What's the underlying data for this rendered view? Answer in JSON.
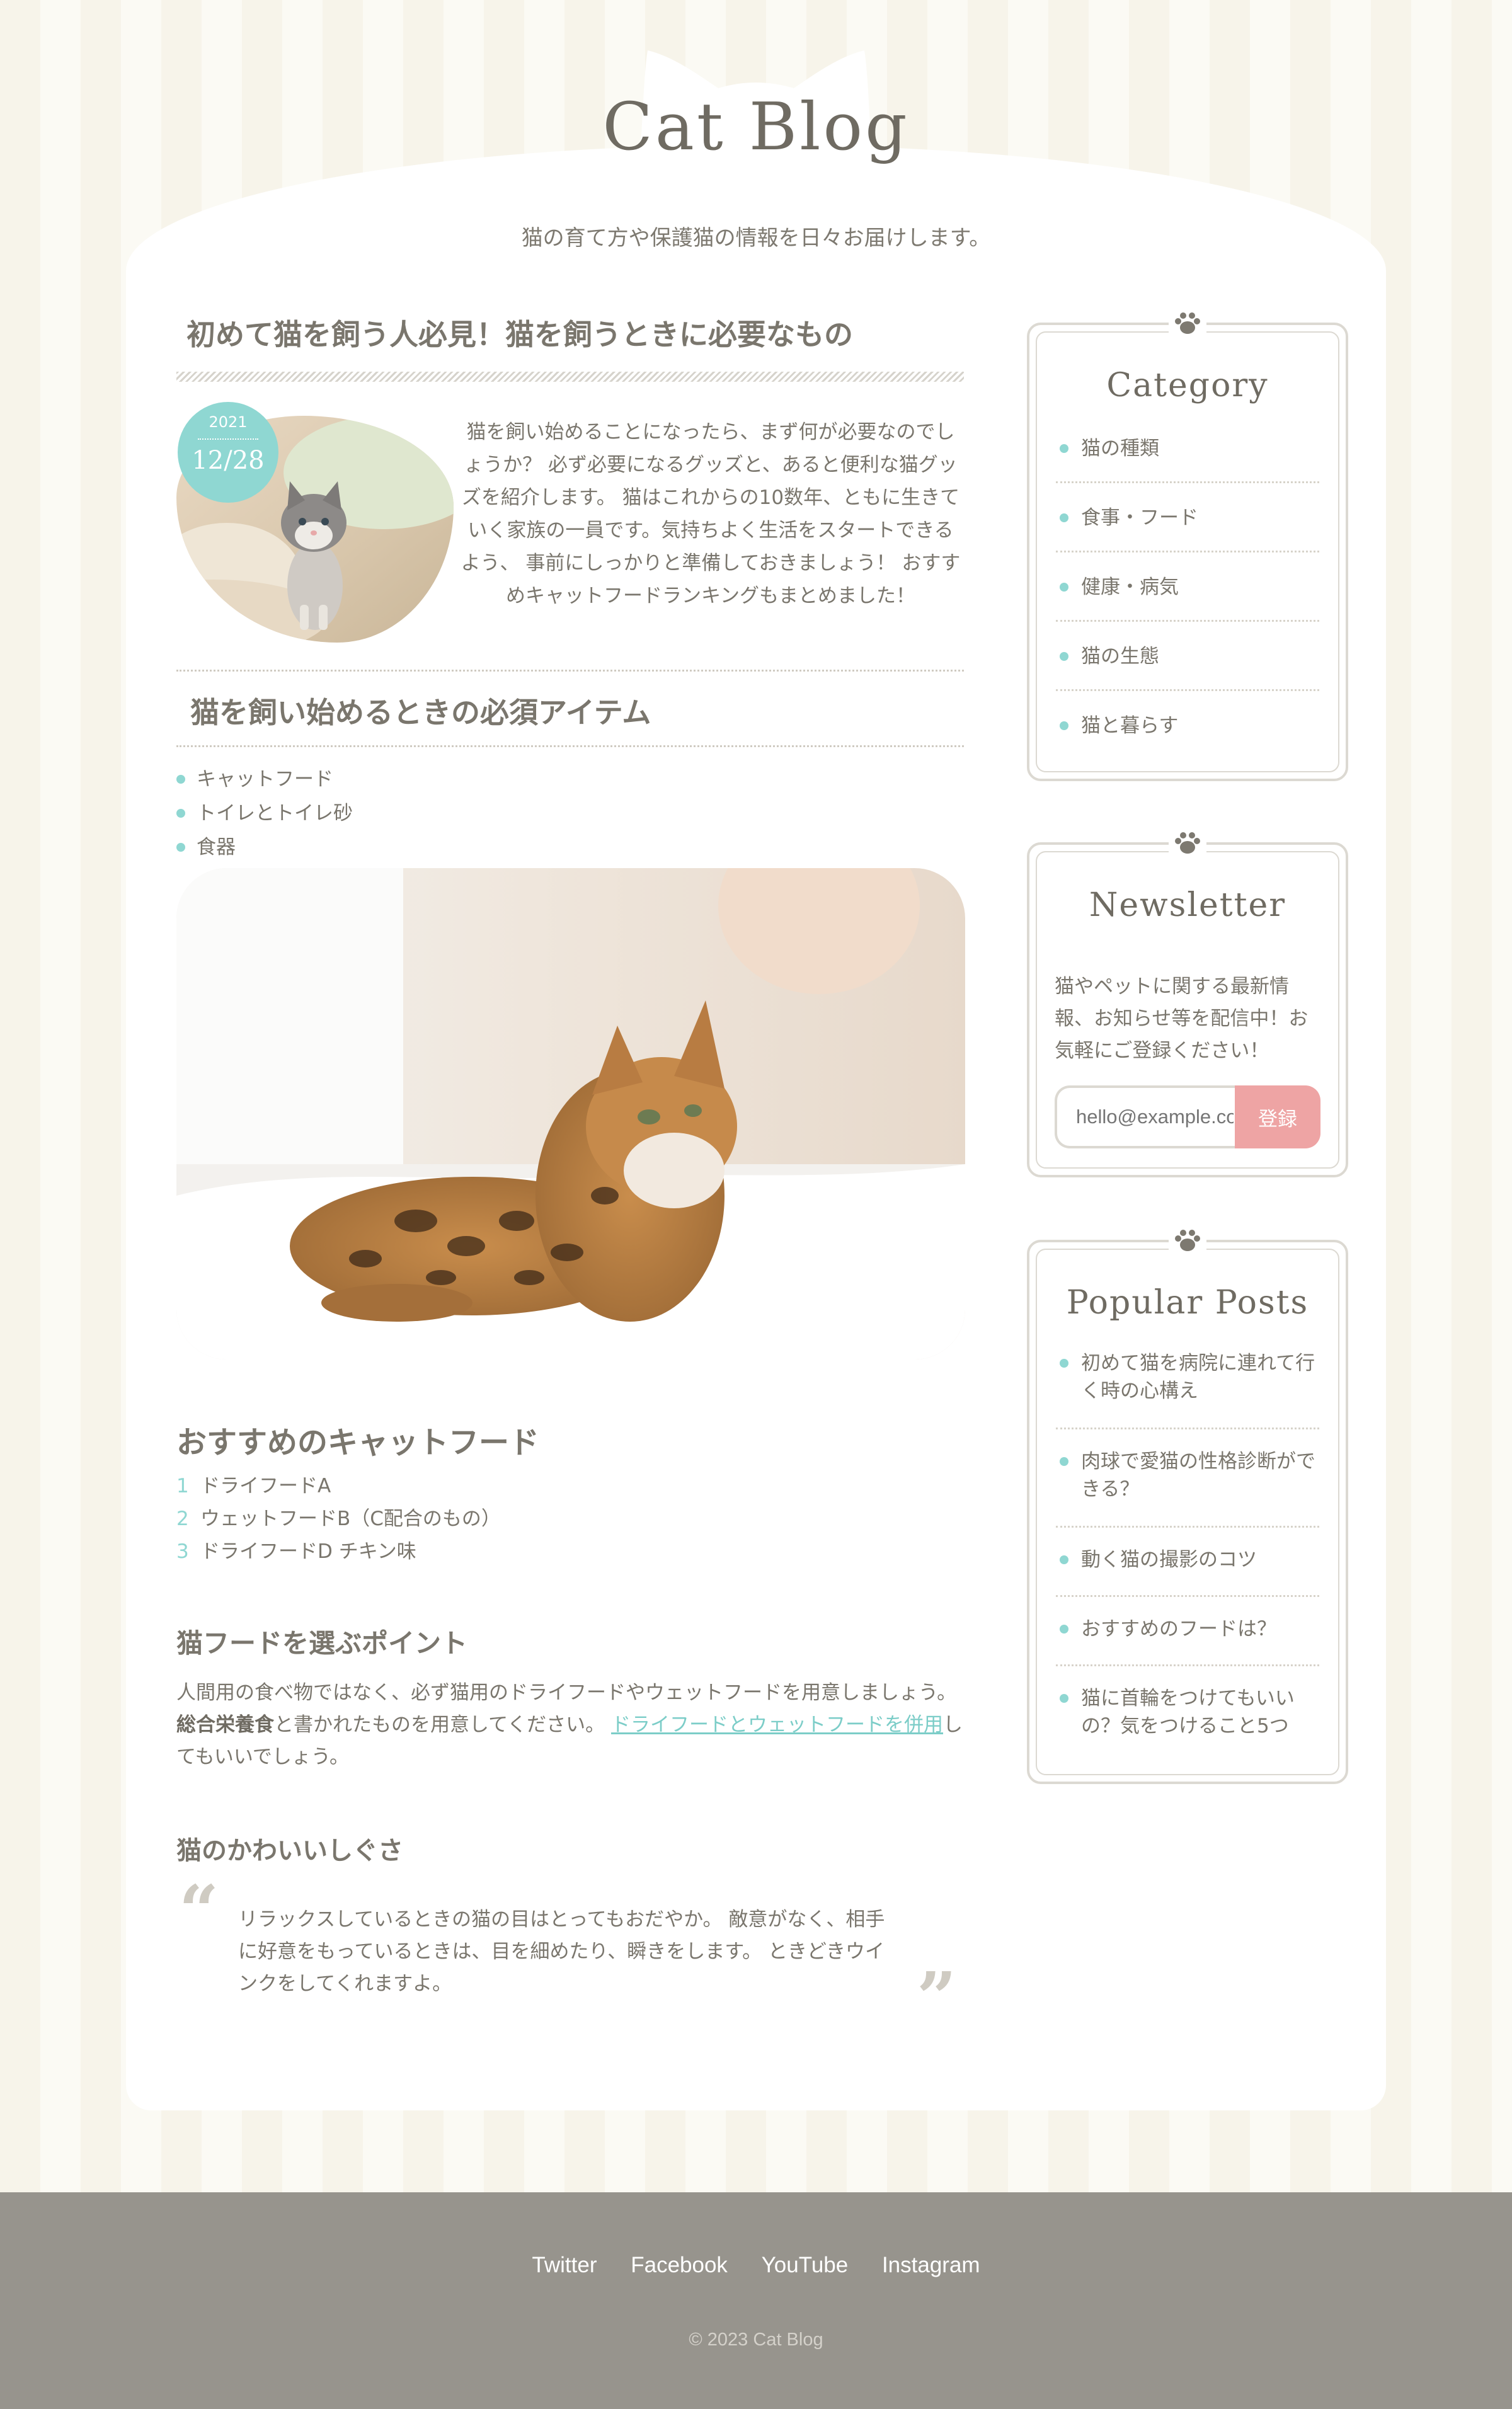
{
  "site": {
    "logo": "Cat Blog",
    "tagline": "猫の育て方や保護猫の情報を日々お届けします。"
  },
  "article": {
    "title": "初めて猫を飼う人必見！猫を飼うときに必要なもの",
    "date_year": "2021",
    "date_md": "12/28",
    "intro": "猫を飼い始めることになったら、まず何が必要なのでしょうか？ 必ず必要になるグッズと、あると便利な猫グッズを紹介します。 猫はこれからの10数年、ともに生きていく家族の一員です。気持ちよく生活をスタートできるよう、 事前にしっかりと準備しておきましょう！ おすすめキャットフードランキングもまとめました！",
    "section_heading": "猫を飼い始めるときの必須アイテム",
    "items": [
      "キャットフード",
      "トイレとトイレ砂",
      "食器"
    ],
    "food_heading": "おすすめのキャットフード",
    "foods": [
      {
        "num": "1",
        "label": "ドライフードA"
      },
      {
        "num": "2",
        "label": "ウェットフードB（C配合のもの）"
      },
      {
        "num": "3",
        "label": "ドライフードD チキン味"
      }
    ],
    "points_heading": "猫フードを選ぶポイント",
    "points_text_1": "人間用の食べ物ではなく、必ず猫用のドライフードやウェットフードを用意しましょう。 ",
    "points_bold": "総合栄養食",
    "points_text_2": "と書かれたものを用意してください。 ",
    "points_link": "ドライフードとウェットフードを併用",
    "points_text_3": "してもいいでしょう。",
    "cute_heading": "猫のかわいいしぐさ",
    "quote": "リラックスしているときの猫の目はとってもおだやか。 敵意がなく、相手に好意をもっているときは、目を細めたり、瞬きをします。 ときどきウインクをしてくれますよ。"
  },
  "sidebar": {
    "category": {
      "title": "Category",
      "items": [
        "猫の種類",
        "食事・フード",
        "健康・病気",
        "猫の生態",
        "猫と暮らす"
      ]
    },
    "newsletter": {
      "title": "Newsletter",
      "text": "猫やペットに関する最新情報、お知らせ等を配信中！お気軽にご登録ください！",
      "placeholder": "hello@example.com",
      "button": "登録"
    },
    "popular": {
      "title": "Popular Posts",
      "items": [
        "初めて猫を病院に連れて行く時の心構え",
        "肉球で愛猫の性格診断ができる？",
        "動く猫の撮影のコツ",
        "おすすめのフードは？",
        "猫に首輪をつけてもいいの？気をつけること5つ"
      ]
    }
  },
  "footer": {
    "links": [
      "Twitter",
      "Facebook",
      "YouTube",
      "Instagram"
    ],
    "copyright": "© 2023 Cat Blog"
  },
  "colors": {
    "accent_teal": "#8fd7d2",
    "button_pink": "#eea4a4",
    "footer_gray": "#97948d"
  }
}
